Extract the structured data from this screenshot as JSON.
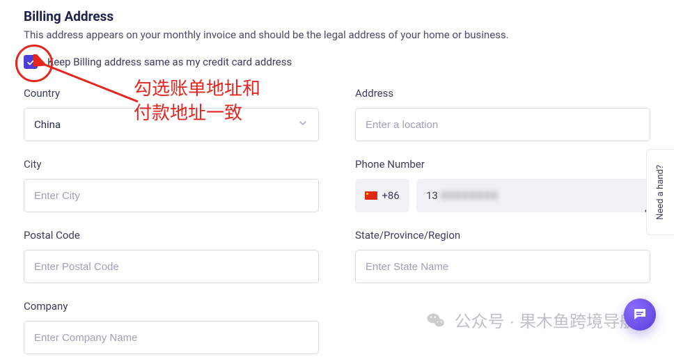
{
  "section": {
    "title": "Billing Address",
    "subtitle": "This address appears on your monthly invoice and should be the legal address of your home or business."
  },
  "checkbox": {
    "checked": true,
    "label": "Keep Billing address same as my credit card address"
  },
  "fields": {
    "country": {
      "label": "Country",
      "value": "China"
    },
    "address": {
      "label": "Address",
      "placeholder": "Enter a location",
      "value": ""
    },
    "city": {
      "label": "City",
      "placeholder": "Enter City",
      "value": ""
    },
    "phone": {
      "label": "Phone Number",
      "cc": "+86",
      "number_prefix": "13",
      "number_masked": "XXXXXXXX"
    },
    "postal": {
      "label": "Postal Code",
      "placeholder": "Enter Postal Code",
      "value": ""
    },
    "region": {
      "label": "State/Province/Region",
      "placeholder": "Enter State Name",
      "value": ""
    },
    "company": {
      "label": "Company",
      "placeholder": "Enter Company Name",
      "value": ""
    }
  },
  "annotation": {
    "line1": "勾选账单地址和",
    "line2": "付款地址一致"
  },
  "help_tab": "Need a hand?",
  "watermark": "公众号 · 果木鱼跨境导航"
}
